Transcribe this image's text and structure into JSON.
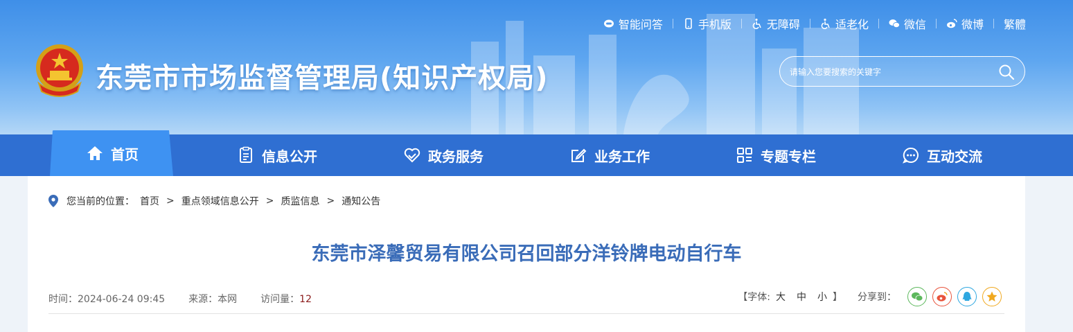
{
  "header": {
    "site_title": "东莞市市场监督管理局(知识产权局)",
    "search_placeholder": "请输入您要搜索的关键字",
    "top_links": [
      {
        "label": "智能问答",
        "icon": "chat-robot-icon"
      },
      {
        "label": "手机版",
        "icon": "mobile-icon"
      },
      {
        "label": "无障碍",
        "icon": "accessibility-icon"
      },
      {
        "label": "适老化",
        "icon": "elderly-icon"
      },
      {
        "label": "微信",
        "icon": "wechat-icon"
      },
      {
        "label": "微博",
        "icon": "weibo-icon"
      },
      {
        "label": "繁體",
        "icon": ""
      }
    ]
  },
  "nav": {
    "items": [
      {
        "label": "首页",
        "icon": "home-icon",
        "active": true
      },
      {
        "label": "信息公开",
        "icon": "document-icon"
      },
      {
        "label": "政务服务",
        "icon": "heart-service-icon"
      },
      {
        "label": "业务工作",
        "icon": "edit-icon"
      },
      {
        "label": "专题专栏",
        "icon": "grid-icon"
      },
      {
        "label": "互动交流",
        "icon": "chat-icon"
      }
    ]
  },
  "breadcrumb": {
    "label": "您当前的位置：",
    "items": [
      "首页",
      "重点领域信息公开",
      "质监信息",
      "通知公告"
    ],
    "separator": ">"
  },
  "article": {
    "title": "东莞市泽馨贸易有限公司召回部分洋铃牌电动自行车",
    "time_label": "时间：",
    "time": "2024-06-24 09:45",
    "source_label": "来源：",
    "source": "本网",
    "views_label": "访问量：",
    "views": "12"
  },
  "tools": {
    "font_open": "【字体:",
    "font_large": "大",
    "font_medium": "中",
    "font_small": "小",
    "font_close": "】",
    "share_label": "分享到：",
    "share": [
      {
        "name": "wechat",
        "color": "#5cb85c"
      },
      {
        "name": "weibo",
        "color": "#e8533b"
      },
      {
        "name": "qq",
        "color": "#2ea7e0"
      },
      {
        "name": "qzone",
        "color": "#f0a81e"
      }
    ]
  }
}
